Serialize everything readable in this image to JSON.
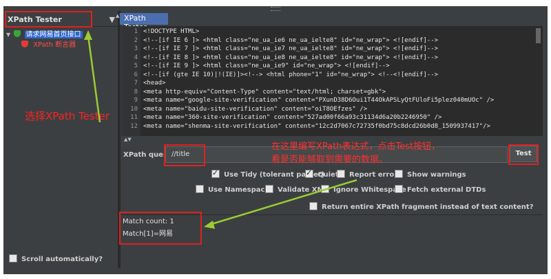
{
  "left_panel": {
    "combo_value": "XPath Tester",
    "tree": [
      {
        "label": "请求网易首页接口"
      },
      {
        "label": "XPath 断言器"
      }
    ],
    "scroll_automatically": "Scroll automatically?"
  },
  "tab": {
    "label": "XPath Tester"
  },
  "code_lines": [
    {
      "n": "1",
      "text": "<!DOCTYPE HTML>"
    },
    {
      "n": "2",
      "text": "<!--[if IE 6 ]> <html class=\"ne_ua_ie6 ne_ua_ielte8\" id=\"ne_wrap\"> <![endif]-->"
    },
    {
      "n": "3",
      "text": "<!--[if IE 7 ]> <html class=\"ne_ua_ie7 ne_ua_ielte8\" id=\"ne_wrap\"> <![endif]-->"
    },
    {
      "n": "4",
      "text": "<!--[if IE 8 ]> <html class=\"ne_ua_ie8 ne_ua_ielte8\" id=\"ne_wrap\"> <![endif]-->"
    },
    {
      "n": "5",
      "text": "<!--[if IE 9 ]> <html class=\"ne_ua_ie9\" id=\"ne_wrap\"> <![endif]-->"
    },
    {
      "n": "6",
      "text": "<!--[if (gte IE 10)|!(IE)]><!--> <html phone=\"1\" id=\"ne_wrap\"> <!--<![endif]-->"
    },
    {
      "n": "7",
      "text": "<head>"
    },
    {
      "n": "8",
      "text": "<meta http-equiv=\"Content-Type\" content=\"text/html; charset=gbk\">"
    },
    {
      "n": "9",
      "text": "<meta name=\"google-site-verification\" content=\"PXunD38D6Oui1T44OkAPSLyQtFUloFi5plez040mUOc\" />"
    },
    {
      "n": "10",
      "text": "<meta name=\"baidu-site-verification\" content=\"oiT8OEfzes\" />"
    },
    {
      "n": "11",
      "text": "<meta name=\"360-site-verification\" content=\"527ad00f66a93c31134d6a20b2246950\" />"
    },
    {
      "n": "12",
      "text": "<meta name=\"shenma-site-verification\" content=\"12c2d7067c72735f0bd75c8dcd26b0d8_1509937417\"/>"
    }
  ],
  "query": {
    "label": "XPath query",
    "value": "//title",
    "test_button": "Test"
  },
  "options": {
    "use_tidy": "Use Tidy (tolerant parser)",
    "quiet": "Quiet",
    "report_errors": "Report errors",
    "show_warnings": "Show warnings",
    "use_namespaces": "Use Namespaces",
    "validate_xml": "Validate XML",
    "ignore_whitespace": "Ignore Whitespace",
    "fetch_dtds": "Fetch external DTDs",
    "return_fragment": "Return entire XPath fragment instead of text content?"
  },
  "results": {
    "match_count": "Match count: 1",
    "match_1": "Match[1]=网易"
  },
  "annotations": {
    "select_tester": "选择XPath Tester",
    "instruction_line1": "在这里编写XPath表达式，点击Test按钮，",
    "instruction_line2": "看是否能够取到需要的数据。"
  },
  "colors": {
    "annotation": "#e02020",
    "arrow": "#9acd32",
    "selection": "#2f65ca"
  }
}
